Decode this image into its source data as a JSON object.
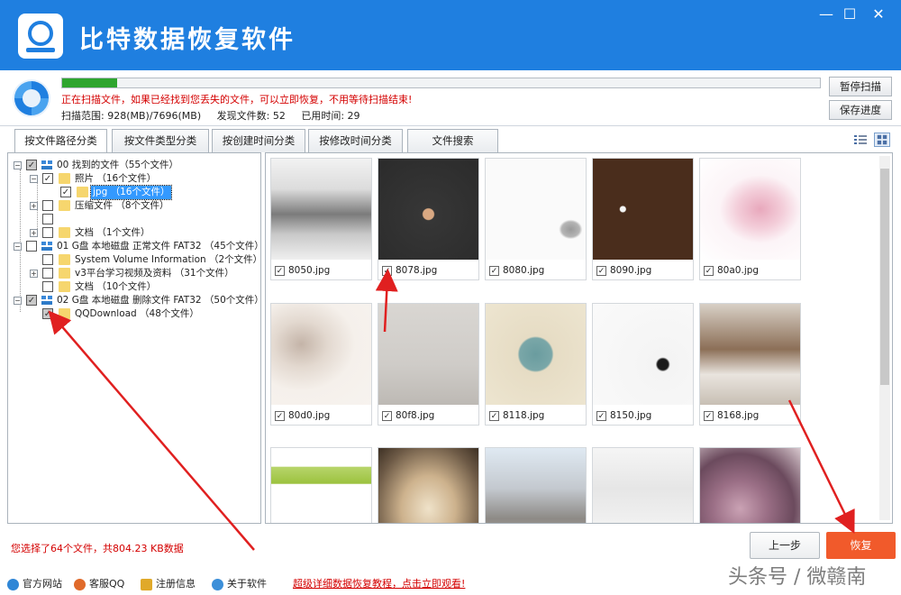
{
  "app": {
    "title": "比特数据恢复软件",
    "min": "—",
    "max": "☐",
    "close": "✕"
  },
  "status": {
    "message": "正在扫描文件，如果已经找到您丢失的文件，可以立即恢复，不用等待扫描结束!",
    "scan_range": "扫描范围: 928(MB)/7696(MB)",
    "found": "发现文件数: 52",
    "elapsed": "已用时间: 29",
    "progress_fraction": 0.072,
    "pause_button": "暂停扫描",
    "save_button": "保存进度"
  },
  "tabs": [
    "按文件路径分类",
    "按文件类型分类",
    "按创建时间分类",
    "按修改时间分类",
    "文件搜索"
  ],
  "tree": [
    {
      "label": "00 找到的文件（55个文件）",
      "icon": "drive"
    },
    {
      "label": "照片  （16个文件）",
      "icon": "folder"
    },
    {
      "label": "jpg  （16个文件）",
      "icon": "folder"
    },
    {
      "label": "压缩文件  （8个文件）",
      "icon": "folder"
    },
    {
      "label": "",
      "icon": ""
    },
    {
      "label": "文档  （1个文件）",
      "icon": "folder"
    },
    {
      "label": "01 G盘 本地磁盘 正常文件 FAT32 （45个文件）",
      "icon": "drive"
    },
    {
      "label": "System Volume Information  （2个文件）",
      "icon": "folder"
    },
    {
      "label": "v3平台学习视频及资料  （31个文件）",
      "icon": "folder"
    },
    {
      "label": "文档  （10个文件）",
      "icon": "folder"
    },
    {
      "label": "02 G盘 本地磁盘 删除文件 FAT32 （50个文件）",
      "icon": "drive"
    },
    {
      "label": "QQDownload  （48个文件）",
      "icon": "folder"
    }
  ],
  "files": [
    {
      "name": "8050.jpg",
      "checked": "✓"
    },
    {
      "name": "8078.jpg",
      "checked": "✓"
    },
    {
      "name": "8080.jpg",
      "checked": "✓"
    },
    {
      "name": "8090.jpg",
      "checked": "✓"
    },
    {
      "name": "80a0.jpg",
      "checked": "✓"
    },
    {
      "name": "80d0.jpg",
      "checked": "✓"
    },
    {
      "name": "80f8.jpg",
      "checked": "✓"
    },
    {
      "name": "8118.jpg",
      "checked": "✓"
    },
    {
      "name": "8150.jpg",
      "checked": "✓"
    },
    {
      "name": "8168.jpg",
      "checked": "✓"
    },
    {
      "name": "",
      "checked": ""
    },
    {
      "name": "",
      "checked": ""
    },
    {
      "name": "",
      "checked": ""
    },
    {
      "name": "",
      "checked": ""
    },
    {
      "name": "",
      "checked": ""
    }
  ],
  "selection": "您选择了64个文件，共804.23 KB数据",
  "buttons": {
    "prev": "上一步",
    "recover": "恢复"
  },
  "footer": {
    "website": "官方网站",
    "support": "客服QQ",
    "register": "注册信息",
    "about": "关于软件",
    "tutorial": "超级详细数据恢复教程，点击立即观看!"
  },
  "watermark": "头条号 / 微赣南",
  "colors": {
    "brand": "#1f7fe0",
    "recover": "#f15a2b",
    "alert": "#d40000",
    "progress": "#2fa52f"
  }
}
